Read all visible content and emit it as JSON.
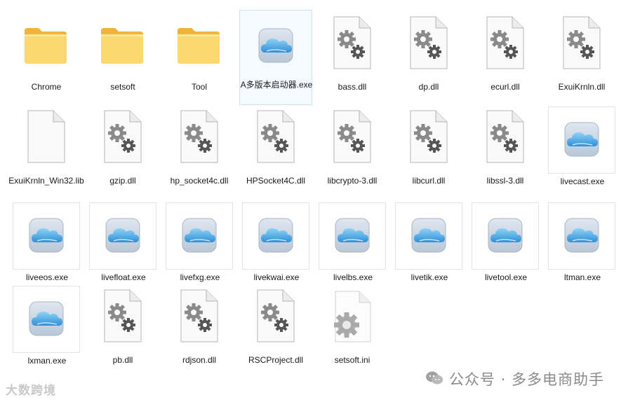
{
  "files": [
    {
      "name": "Chrome",
      "type": "folder"
    },
    {
      "name": "setsoft",
      "type": "folder"
    },
    {
      "name": "Tool",
      "type": "folder"
    },
    {
      "name": "A多版本启动器.exe",
      "type": "exe",
      "selected": true
    },
    {
      "name": "bass.dll",
      "type": "dll"
    },
    {
      "name": "dp.dll",
      "type": "dll"
    },
    {
      "name": "ecurl.dll",
      "type": "dll"
    },
    {
      "name": "ExuiKrnln.dll",
      "type": "dll"
    },
    {
      "name": "ExuiKrnln_Win32.lib",
      "type": "lib"
    },
    {
      "name": "gzip.dll",
      "type": "dll"
    },
    {
      "name": "hp_socket4c.dll",
      "type": "dll"
    },
    {
      "name": "HPSocket4C.dll",
      "type": "dll"
    },
    {
      "name": "libcrypto-3.dll",
      "type": "dll"
    },
    {
      "name": "libcurl.dll",
      "type": "dll"
    },
    {
      "name": "libssl-3.dll",
      "type": "dll"
    },
    {
      "name": "livecast.exe",
      "type": "exe"
    },
    {
      "name": "liveeos.exe",
      "type": "exe"
    },
    {
      "name": "livefloat.exe",
      "type": "exe"
    },
    {
      "name": "livefxg.exe",
      "type": "exe"
    },
    {
      "name": "livekwai.exe",
      "type": "exe"
    },
    {
      "name": "livelbs.exe",
      "type": "exe"
    },
    {
      "name": "livetik.exe",
      "type": "exe"
    },
    {
      "name": "livetool.exe",
      "type": "exe"
    },
    {
      "name": "ltman.exe",
      "type": "exe"
    },
    {
      "name": "lxman.exe",
      "type": "exe"
    },
    {
      "name": "pb.dll",
      "type": "dll"
    },
    {
      "name": "rdjson.dll",
      "type": "dll"
    },
    {
      "name": "RSCProject.dll",
      "type": "dll"
    },
    {
      "name": "setsoft.ini",
      "type": "ini"
    }
  ],
  "icons": {
    "folder": "folder-icon",
    "exe": "cloud-app-icon",
    "dll": "gears-file-icon",
    "lib": "blank-file-icon",
    "ini": "settings-gear-icon"
  },
  "colors": {
    "folder_front": "#fcd870",
    "folder_back": "#f0b43a",
    "selection_border": "#cfe3f7",
    "gear": "#7a7a7a"
  },
  "watermark": {
    "left": "大数跨境",
    "right": "公众号 · 多多电商助手"
  }
}
